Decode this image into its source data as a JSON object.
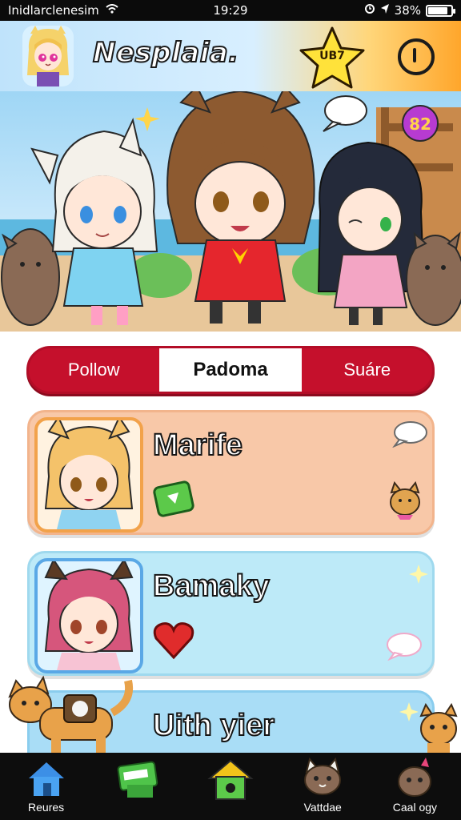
{
  "status_bar": {
    "carrier": "Inidlarclenesim",
    "time": "19:29",
    "battery_text": "38%",
    "battery_level": 0.88
  },
  "header": {
    "title": "Nesplaia.",
    "star_label": "UB7"
  },
  "hero": {
    "bubble_badge": "82"
  },
  "tabs": [
    {
      "label": "Pollow",
      "active": false
    },
    {
      "label": "Padoma",
      "active": true
    },
    {
      "label": "Suáre",
      "active": false
    }
  ],
  "cards": [
    {
      "name": "Marife",
      "icon": "green-tag-icon",
      "color": "#f8c8a8"
    },
    {
      "name": "Bamaky",
      "icon": "heart-icon",
      "color": "#bdeaf8"
    },
    {
      "name": "Uith yier",
      "icon": "sparkle-icon",
      "color": "#a9ddf6"
    }
  ],
  "bottom_nav": [
    {
      "label": "Reures",
      "icon": "home-icon"
    },
    {
      "label": "",
      "icon": "ticket-icon"
    },
    {
      "label": "",
      "icon": "birdhouse-icon"
    },
    {
      "label": "Vattdae",
      "icon": "cat-icon"
    },
    {
      "label": "Caal ogy",
      "icon": "animal-icon"
    }
  ],
  "colors": {
    "tab_red": "#c5102c",
    "accent_orange": "#ffa62b",
    "star_yellow": "#ffe23a"
  }
}
